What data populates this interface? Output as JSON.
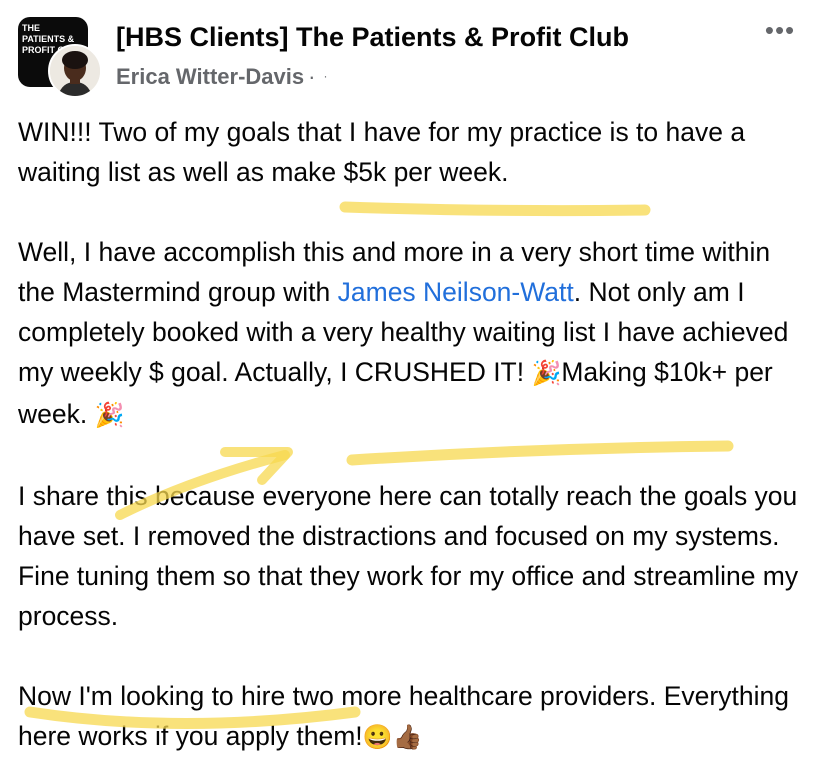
{
  "group": {
    "avatar_text": "THE PATIENTS & PROFIT CLUB",
    "title": "[HBS Clients] The Patients & Profit Club"
  },
  "post": {
    "author": "Erica Witter-Davis",
    "separator": "·",
    "privacy_glyph": "·",
    "more_label": "•••",
    "p1": "WIN!!! Two of my goals that I have for my practice is to have a waiting list as well as make $5k per week.",
    "p2_before": "Well, I have accomplish this and more in a very short time within the Mastermind group with ",
    "p2_mention": "James Neilson-Watt",
    "p2_after1": ". Not only am I completely booked with a very healthy waiting list I have achieved my weekly $ goal. Actually, I CRUSHED IT! ",
    "p2_emoji1": "🎉",
    "p2_making": "Making $10k+ per week.",
    "p2_emoji2": "🎉",
    "p3": "I share this because everyone here can totally reach the goals you have set. I removed the distractions and focused on my systems. Fine tuning them so that they work for my office and streamline my process.",
    "p4_text": "Now I'm looking to hire two more healthcare providers. Everything here works if you apply them!",
    "p4_emoji1": "😀",
    "p4_emoji2": "👍🏾"
  },
  "colors": {
    "highlighter": "#f7d84f",
    "mention": "#216fdb",
    "secondary_text": "#65676b"
  }
}
